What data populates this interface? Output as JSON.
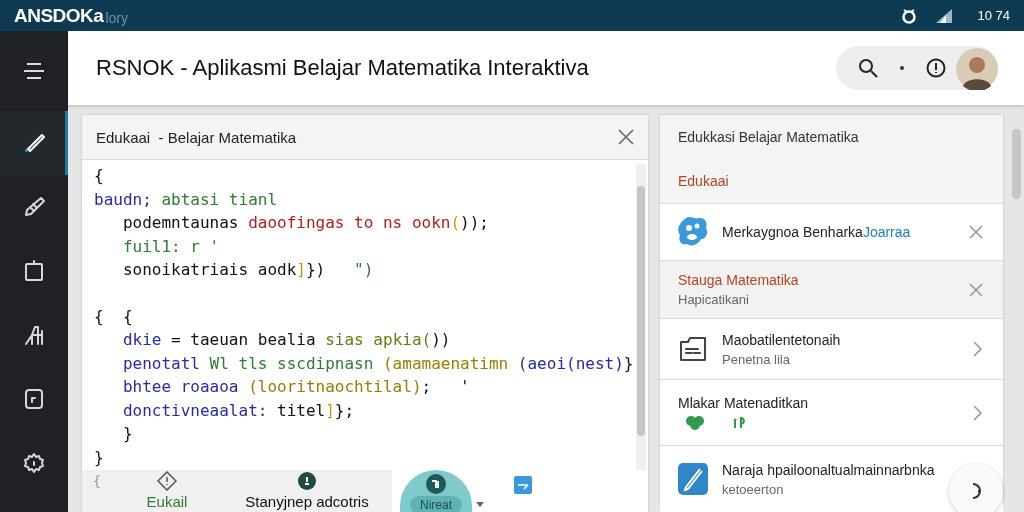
{
  "status_bar": {
    "logo": "ANSDOKa",
    "logo_suffix": "lory",
    "time": "10 74"
  },
  "sidebar": {
    "items": [
      {
        "selected": true
      },
      {
        "selected": false
      },
      {
        "selected": false
      },
      {
        "selected": false
      },
      {
        "selected": false
      },
      {
        "selected": false
      }
    ]
  },
  "header": {
    "title": "RSNOK - Aplikasmi Belajar Matematika Interaktiva"
  },
  "editor": {
    "title": "Edukaai  - Belajar Matematika",
    "blocks": [
      [
        [
          {
            "text": "{",
            "color": "#111111"
          }
        ],
        [
          {
            "text": "baudn;",
            "color": "#2a2aa8"
          },
          {
            "text": " abtasi tianl",
            "color": "#2e7d32"
          }
        ],
        [
          {
            "text": "   podemntaunas ",
            "color": "#111111"
          },
          {
            "text": "daoofingas to ns ookn",
            "color": "#b71c1c"
          },
          {
            "text": "(",
            "color": "#c79a00"
          },
          {
            "text": "));",
            "color": "#111111"
          }
        ],
        [
          {
            "text": "   fuil1: r '",
            "color": "#2e7d32"
          }
        ],
        [
          {
            "text": "   sonoikatriais aodk",
            "color": "#111111"
          },
          {
            "text": "]",
            "color": "#c79a00"
          },
          {
            "text": "})",
            "color": "#111111"
          },
          {
            "text": "   \")",
            "color": "#2e7d32"
          }
        ]
      ],
      [
        [
          {
            "text": "{  {",
            "color": "#111111"
          }
        ],
        [
          {
            "text": "   dkie",
            "color": "#2a2aa8"
          },
          {
            "text": " = taeuan bealia ",
            "color": "#111111"
          },
          {
            "text": "sias apkia(",
            "color": "#5f7d12"
          },
          {
            "text": "))",
            "color": "#111111"
          }
        ],
        [
          {
            "text": "   penotatl ",
            "color": "#2a2aa8"
          },
          {
            "text": "Wl tls sscdipnasn ",
            "color": "#2e7d32"
          },
          {
            "text": "(amamaenatimn ",
            "color": "#9a7d00"
          },
          {
            "text": "(aeoi(nest)",
            "color": "#2a2aa8"
          },
          {
            "text": "}",
            "color": "#111111"
          }
        ],
        [
          {
            "text": "   bhtee roaaoa ",
            "color": "#2a2aa8"
          },
          {
            "text": "(looritnaochtilal)",
            "color": "#9a7d00"
          },
          {
            "text": ";   '",
            "color": "#111111"
          }
        ],
        [
          {
            "text": "   donctivneaalat: ",
            "color": "#2a2aa8"
          },
          {
            "text": "titel",
            "color": "#111111"
          },
          {
            "text": "]",
            "color": "#c79a00"
          },
          {
            "text": "};",
            "color": "#111111"
          }
        ],
        [
          {
            "text": "   }",
            "color": "#111111"
          }
        ],
        [
          {
            "text": "}",
            "color": "#111111"
          }
        ]
      ]
    ],
    "toolbar": {
      "brace": "{",
      "left_label": "Eukail",
      "middle_label": "Stanyjnep adcotris",
      "pill": "Nireat"
    }
  },
  "panel": {
    "title": "Edukkasi Belajar Matematika",
    "section": "Edukaai",
    "items": [
      {
        "kind": "blob",
        "title": "Merkaygnoa Benharka",
        "link": "Joarraa",
        "trailing": {
          "kind": "close"
        },
        "selected": false
      },
      {
        "kind": "plain",
        "title": "Stauga Matematika",
        "subtitle": "Hapicatikani",
        "trailing": {
          "kind": "close"
        },
        "selected": true
      },
      {
        "kind": "doc",
        "title": "Maobatilentetonaih",
        "subtitle": "Penetna lila",
        "trailing": {
          "kind": "chevron"
        },
        "selected": false
      },
      {
        "kind": "badges",
        "title": "Mlakar Matenaditkan",
        "trailing": {
          "kind": "chevron"
        },
        "selected": false
      },
      {
        "kind": "pen",
        "title": "Naraja hpailoonaltualmainnarbnka",
        "subtitle": "ketoeerton",
        "trailing": {
          "kind": "fab"
        },
        "selected": false
      }
    ]
  }
}
